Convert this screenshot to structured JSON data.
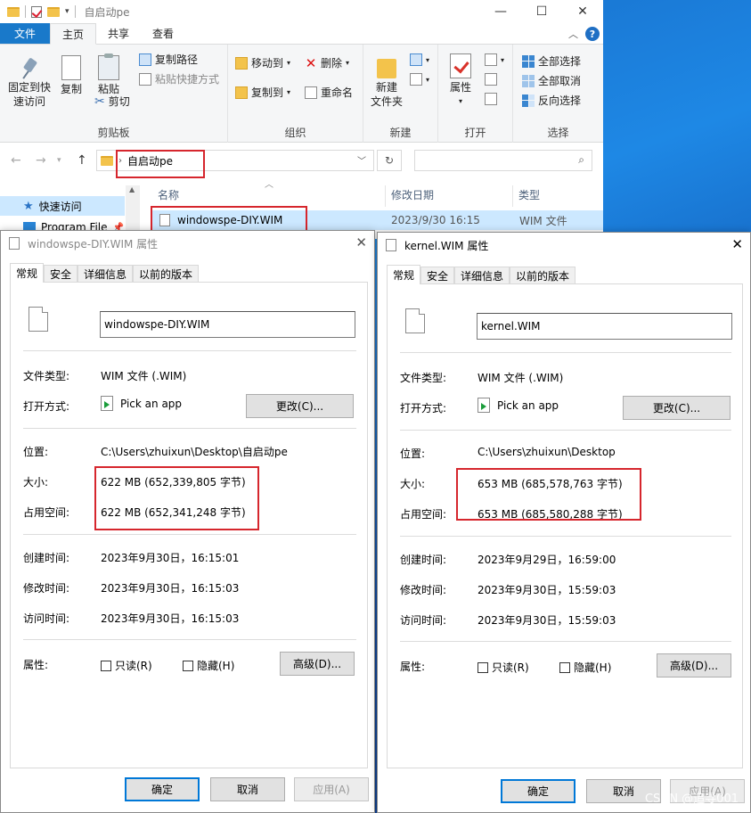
{
  "explorer": {
    "title": "自启动pe",
    "tabs": {
      "file": "文件",
      "home": "主页",
      "share": "共享",
      "view": "查看"
    },
    "ribbon": {
      "pin_label_1": "固定到快",
      "pin_label_2": "速访问",
      "copy": "复制",
      "paste": "粘贴",
      "copy_path": "复制路径",
      "paste_shortcut": "粘贴快捷方式",
      "cut": "剪切",
      "clipboard_group": "剪贴板",
      "move_to": "移动到",
      "copy_to": "复制到",
      "delete": "删除",
      "rename": "重命名",
      "organize_group": "组织",
      "new_folder_1": "新建",
      "new_folder_2": "文件夹",
      "new_group": "新建",
      "properties": "属性",
      "open_group": "打开",
      "select_all": "全部选择",
      "select_none": "全部取消",
      "invert_selection": "反向选择",
      "select_group": "选择"
    },
    "address": {
      "path": "自启动pe"
    },
    "nav": {
      "quick_access": "快速访问",
      "program_files": "Program File"
    },
    "columns": {
      "name": "名称",
      "modified": "修改日期",
      "type": "类型"
    },
    "file_row": {
      "name": "windowspe-DIY.WIM",
      "date": "2023/9/30 16:15",
      "type": "WIM 文件"
    }
  },
  "dialogs": [
    {
      "title": "windowspe-DIY.WIM 属性",
      "tabs": [
        "常规",
        "安全",
        "详细信息",
        "以前的版本"
      ],
      "filename": "windowspe-DIY.WIM",
      "labels": {
        "type": "文件类型:",
        "open_with": "打开方式:",
        "location": "位置:",
        "size": "大小:",
        "size_on_disk": "占用空间:",
        "created": "创建时间:",
        "modified": "修改时间:",
        "accessed": "访问时间:",
        "attributes": "属性:"
      },
      "file_type": "WIM 文件 (.WIM)",
      "open_with": "Pick an app",
      "change_btn": "更改(C)...",
      "location": "C:\\Users\\zhuixun\\Desktop\\自启动pe",
      "size": "622 MB (652,339,805 字节)",
      "size_on_disk": "622 MB (652,341,248 字节)",
      "created": "2023年9月30日，16:15:01",
      "modified": "2023年9月30日，16:15:03",
      "accessed": "2023年9月30日，16:15:03",
      "readonly": "只读(R)",
      "hidden": "隐藏(H)",
      "advanced_btn": "高级(D)...",
      "ok": "确定",
      "cancel": "取消",
      "apply": "应用(A)"
    },
    {
      "title": "kernel.WIM 属性",
      "tabs": [
        "常规",
        "安全",
        "详细信息",
        "以前的版本"
      ],
      "filename": "kernel.WIM",
      "labels": {
        "type": "文件类型:",
        "open_with": "打开方式:",
        "location": "位置:",
        "size": "大小:",
        "size_on_disk": "占用空间:",
        "created": "创建时间:",
        "modified": "修改时间:",
        "accessed": "访问时间:",
        "attributes": "属性:"
      },
      "file_type": "WIM 文件 (.WIM)",
      "open_with": "Pick an app",
      "change_btn": "更改(C)...",
      "location": "C:\\Users\\zhuixun\\Desktop",
      "size": "653 MB (685,578,763 字节)",
      "size_on_disk": "653 MB (685,580,288 字节)",
      "created": "2023年9月29日，16:59:00",
      "modified": "2023年9月30日，15:59:03",
      "accessed": "2023年9月30日，15:59:03",
      "readonly": "只读(R)",
      "hidden": "隐藏(H)",
      "advanced_btn": "高级(D)...",
      "ok": "确定",
      "cancel": "取消",
      "apply": "应用(A)"
    }
  ],
  "watermark": "CSDN @追寻001",
  "colors": {
    "accent": "#1979ca",
    "highlight_box": "#d6262d",
    "selection": "#cce8ff"
  }
}
